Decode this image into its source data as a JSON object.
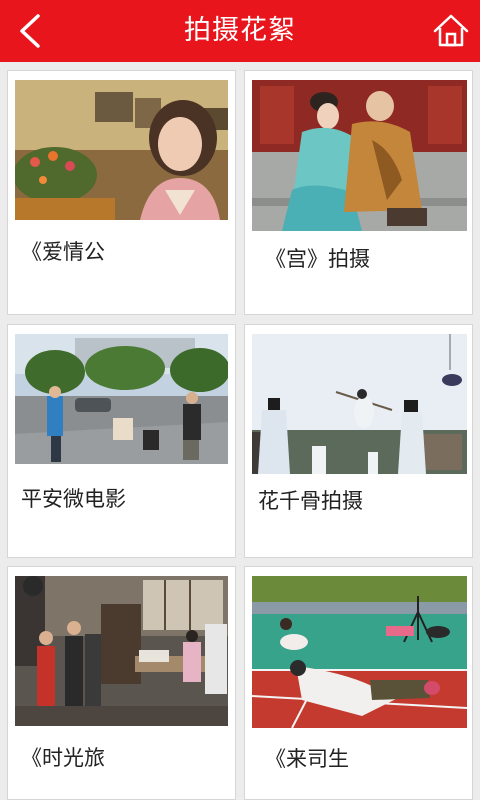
{
  "header": {
    "title": "拍摄花絮",
    "back_icon": "chevron-left-icon",
    "home_icon": "home-icon",
    "background": "#e8161c"
  },
  "items": [
    {
      "caption": "《爱情公"
    },
    {
      "caption": "《宫》拍摄"
    },
    {
      "caption": "平安微电影"
    },
    {
      "caption": "花千骨拍摄"
    },
    {
      "caption": "《时光旅"
    },
    {
      "caption": "《来司生"
    }
  ]
}
